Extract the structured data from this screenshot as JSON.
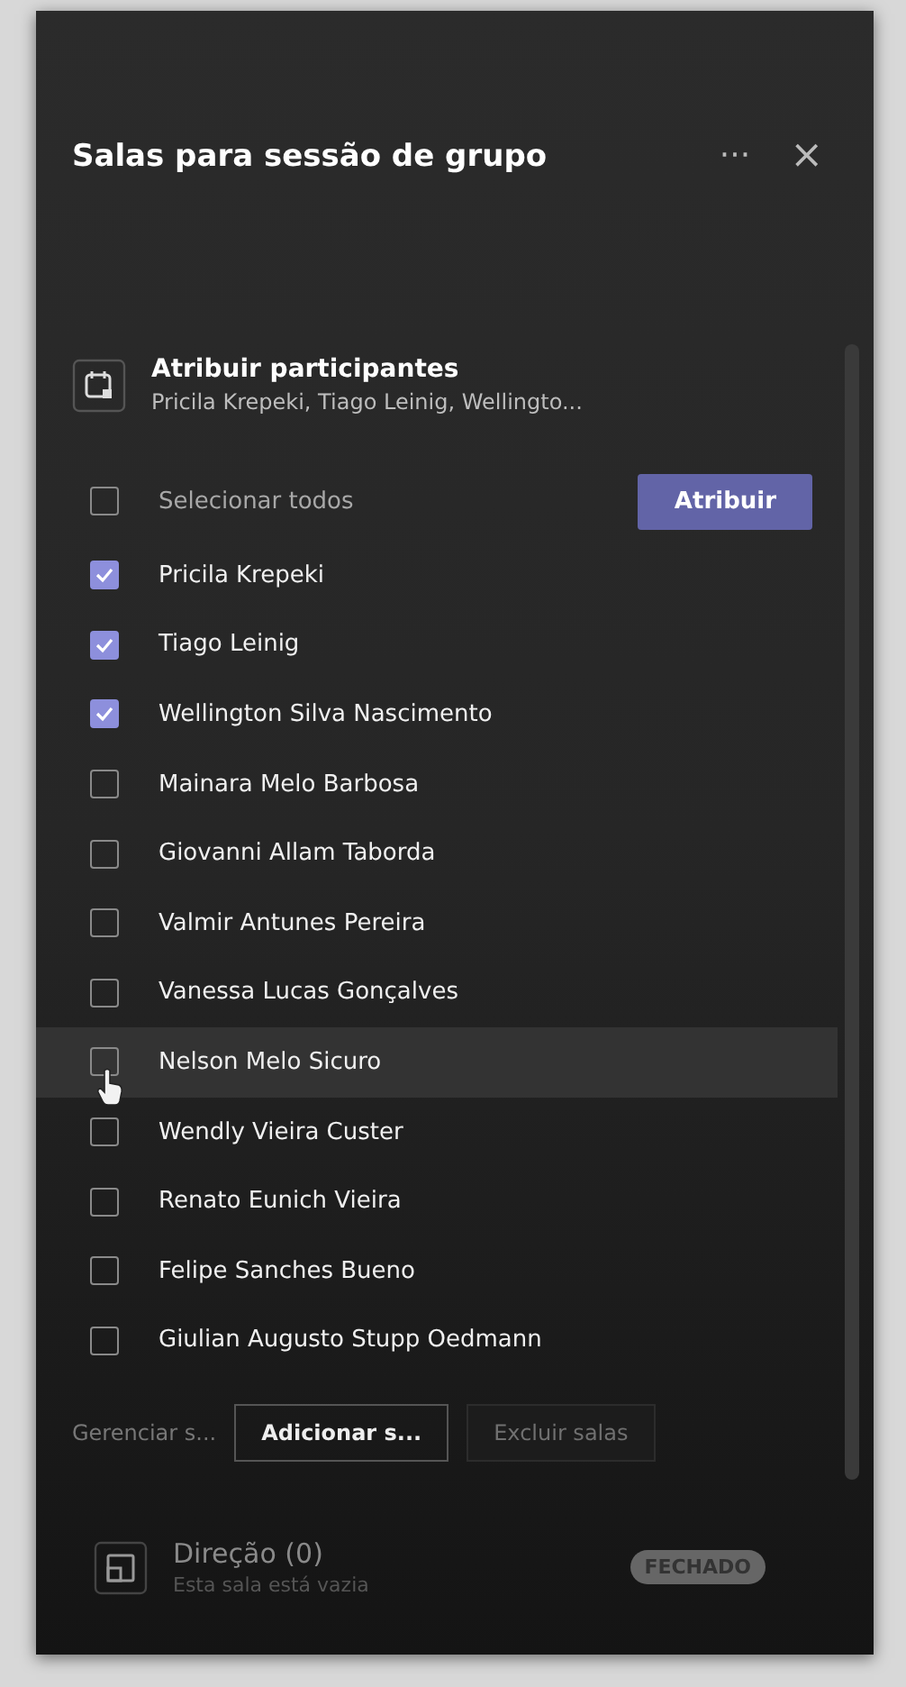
{
  "panel": {
    "title": "Salas para sessão de grupo",
    "more": "···",
    "close": "×"
  },
  "assign": {
    "title": "Atribuir participantes",
    "subtitle": "Pricila Krepeki, Tiago Leinig, Wellingto..."
  },
  "select_all": {
    "label": "Selecionar todos",
    "checked": false
  },
  "assign_button": "Atribuir",
  "participants": [
    {
      "name": "Pricila Krepeki",
      "checked": true,
      "hovered": false
    },
    {
      "name": "Tiago Leinig",
      "checked": true,
      "hovered": false
    },
    {
      "name": "Wellington Silva Nascimento",
      "checked": true,
      "hovered": false
    },
    {
      "name": "Mainara Melo Barbosa",
      "checked": false,
      "hovered": false
    },
    {
      "name": "Giovanni Allam Taborda",
      "checked": false,
      "hovered": false
    },
    {
      "name": "Valmir Antunes Pereira",
      "checked": false,
      "hovered": false
    },
    {
      "name": "Vanessa Lucas Gonçalves",
      "checked": false,
      "hovered": false
    },
    {
      "name": "Nelson Melo Sicuro",
      "checked": false,
      "hovered": true
    },
    {
      "name": "Wendly Vieira Custer",
      "checked": false,
      "hovered": false
    },
    {
      "name": "Renato Eunich Vieira",
      "checked": false,
      "hovered": false
    },
    {
      "name": "Felipe Sanches Bueno",
      "checked": false,
      "hovered": false
    },
    {
      "name": "Giulian Augusto Stupp Oedmann",
      "checked": false,
      "hovered": false
    }
  ],
  "actions": [
    {
      "label": "Gerenciar s...",
      "kind": "link",
      "disabled": false
    },
    {
      "label": "Adicionar s...",
      "kind": "outlined",
      "disabled": false
    },
    {
      "label": "Excluir salas",
      "kind": "outlined",
      "disabled": true
    }
  ],
  "room": {
    "name": "Direção (0)",
    "status": "Esta sala está vazia",
    "badge": "FECHADO"
  }
}
